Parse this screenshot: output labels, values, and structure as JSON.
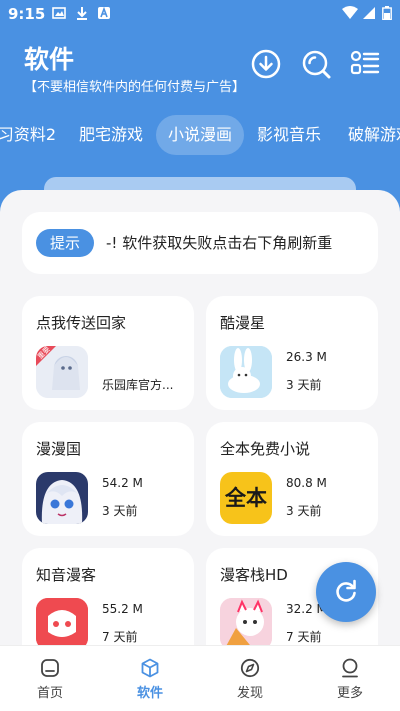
{
  "status": {
    "time": "9:15"
  },
  "header": {
    "title": "软件",
    "subtitle": "【不要相信软件内的任何付费与广告】"
  },
  "tabs": [
    {
      "label": "习资料2"
    },
    {
      "label": "肥宅游戏"
    },
    {
      "label": "小说漫画",
      "active": true
    },
    {
      "label": "影视音乐"
    },
    {
      "label": "破解游戏"
    }
  ],
  "notice": {
    "tag": "提示",
    "text": "-!   软件获取失败点击右下角刷新重"
  },
  "cards": [
    {
      "name": "点我传送回家",
      "publisher": "乐园库官方...",
      "badge": "重要"
    },
    {
      "name": "酷漫星",
      "size": "26.3 M",
      "date": "3 天前"
    },
    {
      "name": "漫漫国",
      "size": "54.2 M",
      "date": "3 天前"
    },
    {
      "name": "全本免费小说",
      "size": "80.8 M",
      "date": "3 天前",
      "icon_text": "全本"
    },
    {
      "name": "知音漫客",
      "size": "55.2 M",
      "date": "7 天前"
    },
    {
      "name": "漫客栈HD",
      "size": "32.2 M",
      "date": "7 天前"
    }
  ],
  "nav": [
    {
      "label": "首页",
      "icon": "home-icon"
    },
    {
      "label": "软件",
      "icon": "cube-icon",
      "active": true
    },
    {
      "label": "发现",
      "icon": "compass-icon"
    },
    {
      "label": "更多",
      "icon": "user-icon"
    }
  ],
  "colors": {
    "accent": "#4a91e2",
    "background": "#f5f5f7"
  }
}
